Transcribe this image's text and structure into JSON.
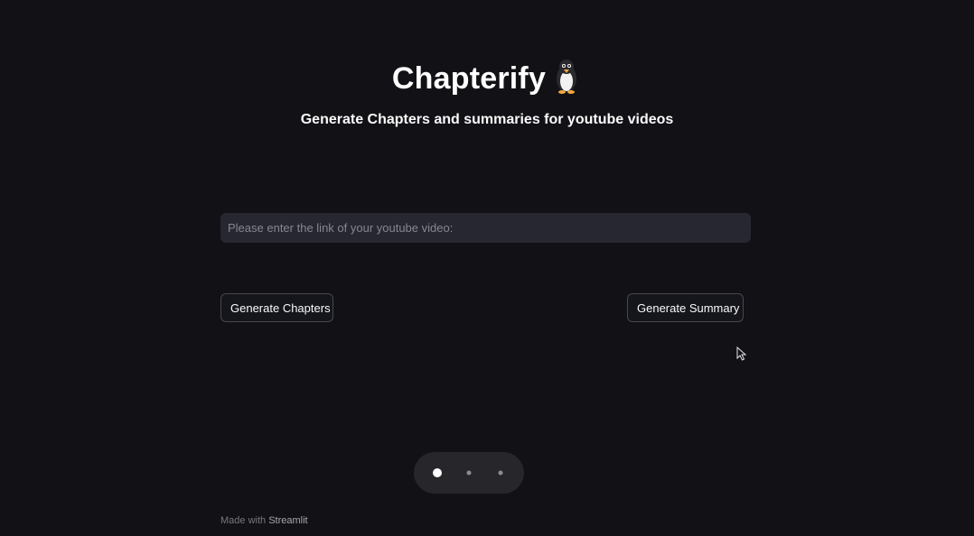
{
  "header": {
    "title": "Chapterify",
    "title_emoji": "penguin-icon",
    "subtitle": "Generate Chapters and summaries for youtube videos"
  },
  "form": {
    "url_placeholder": "Please enter the link of your youtube video:",
    "url_value": ""
  },
  "actions": {
    "chapters_label": "Generate Chapters",
    "summary_label": "Generate Summary"
  },
  "pager": {
    "total": 3,
    "active": 1
  },
  "footer": {
    "prefix": "Made with",
    "brand": "Streamlit"
  },
  "colors": {
    "background": "#111116",
    "input_bg": "#262730",
    "button_bg": "#15161c",
    "text": "#fafafa"
  }
}
